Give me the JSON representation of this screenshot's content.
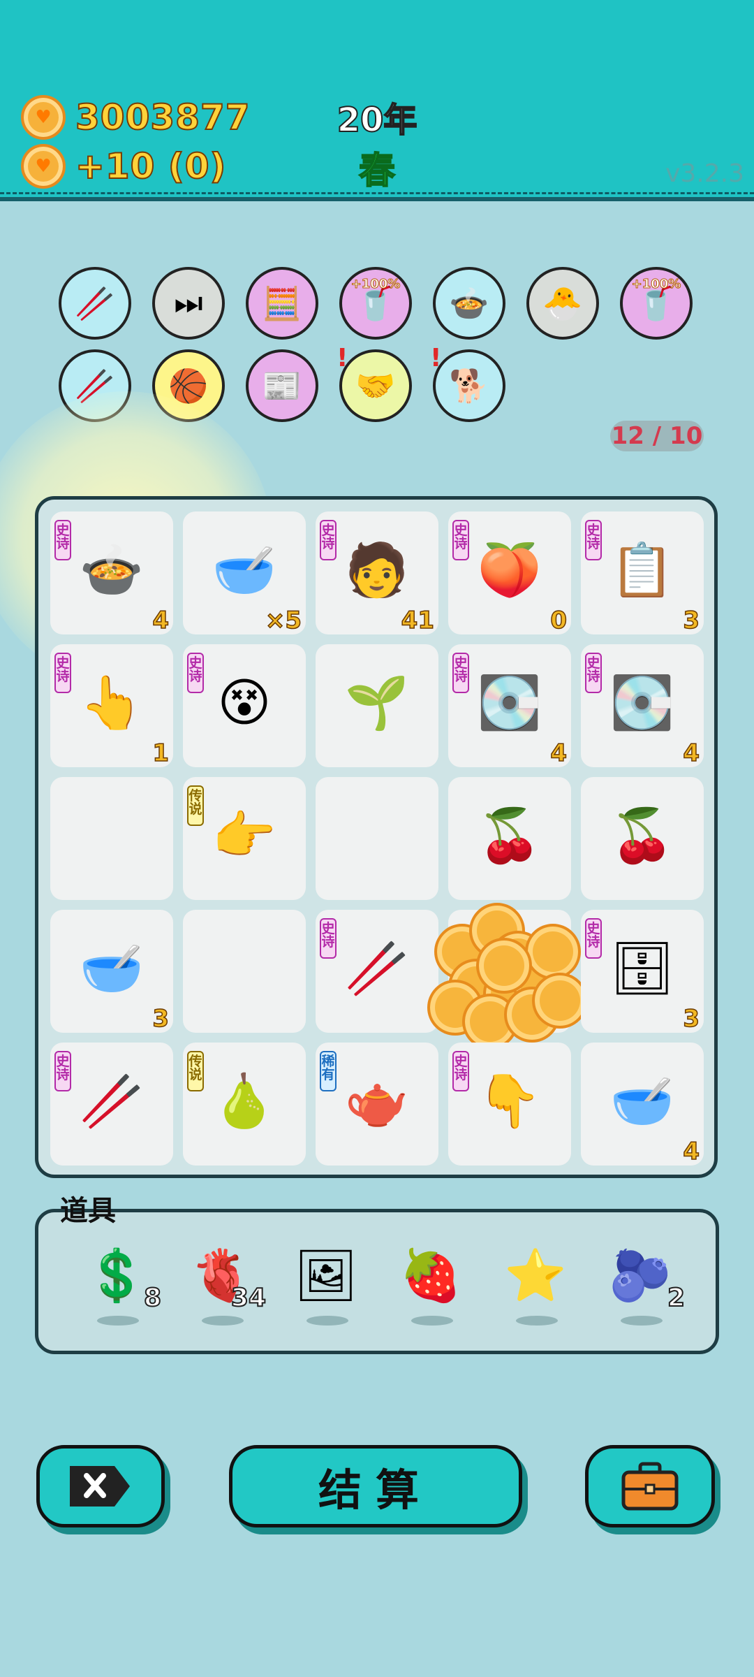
{
  "hud": {
    "coins": "3003877",
    "income": "+10   (0)",
    "year": "20年",
    "season": "春",
    "version": "v3.2.3"
  },
  "artifacts": [
    {
      "icon": "chopsticks",
      "emoji": "🥢",
      "color": "#b9ecf4"
    },
    {
      "icon": "skip-heart",
      "emoji": "⏭",
      "color": "#d9ddd9"
    },
    {
      "icon": "math-glasses",
      "emoji": "🧮",
      "color": "#e8aeea"
    },
    {
      "icon": "milk-tea-boost",
      "emoji": "🥤",
      "color": "#e8aeea",
      "badge": "+100%"
    },
    {
      "icon": "chick-pot",
      "emoji": "🍲",
      "color": "#b9ecf4"
    },
    {
      "icon": "chick-egg",
      "emoji": "🐣",
      "color": "#d9ddd9"
    },
    {
      "icon": "milk-tea-boost-2",
      "emoji": "🥤",
      "color": "#e8aeea",
      "badge": "+100%"
    },
    {
      "icon": "chopsticks-2",
      "emoji": "🥢",
      "color": "#b9ecf4"
    },
    {
      "icon": "basketballs",
      "emoji": "🏀",
      "color": "#fdf58a"
    },
    {
      "icon": "time-magazine",
      "emoji": "📰",
      "color": "#e8aeea"
    },
    {
      "icon": "handshake",
      "emoji": "🤝",
      "color": "#ecf7a7",
      "alert": "!"
    },
    {
      "icon": "shiba-dog",
      "emoji": "🐕",
      "color": "#b9ecf4",
      "alert": "!"
    }
  ],
  "counter": "12 / 10",
  "board": [
    {
      "tag": "史诗",
      "tagType": "epic",
      "icon": "steam-pot",
      "emoji": "🍲",
      "num": "4"
    },
    {
      "tag": "",
      "tagType": "",
      "icon": "tea-bowl",
      "emoji": "🥣",
      "num": "×5"
    },
    {
      "tag": "史诗",
      "tagType": "epic",
      "icon": "man-face",
      "emoji": "🧑",
      "num": "41"
    },
    {
      "tag": "史诗",
      "tagType": "epic",
      "icon": "peach",
      "emoji": "🍑",
      "num": "0"
    },
    {
      "tag": "史诗",
      "tagType": "epic",
      "icon": "copy-paste",
      "emoji": "📋",
      "num": "3"
    },
    {
      "tag": "史诗",
      "tagType": "epic",
      "icon": "pointing-hand-up",
      "emoji": "👆",
      "num": "1"
    },
    {
      "tag": "史诗",
      "tagType": "epic",
      "icon": "confused-face",
      "emoji": "😵",
      "num": ""
    },
    {
      "tag": "",
      "tagType": "",
      "icon": "sprout",
      "emoji": "🌱",
      "num": ""
    },
    {
      "tag": "史诗",
      "tagType": "epic",
      "icon": "graphics-card",
      "emoji": "💽",
      "num": "4"
    },
    {
      "tag": "史诗",
      "tagType": "epic",
      "icon": "graphics-card-2",
      "emoji": "💽",
      "num": "4"
    },
    {
      "tag": "",
      "tagType": "",
      "icon": "empty",
      "emoji": "",
      "num": ""
    },
    {
      "tag": "传说",
      "tagType": "legend",
      "icon": "pointing-hand-right",
      "emoji": "👉",
      "num": ""
    },
    {
      "tag": "",
      "tagType": "",
      "icon": "empty",
      "emoji": "",
      "num": ""
    },
    {
      "tag": "",
      "tagType": "",
      "icon": "cherries",
      "emoji": "🍒",
      "num": ""
    },
    {
      "tag": "",
      "tagType": "",
      "icon": "cherries-2",
      "emoji": "🍒",
      "num": ""
    },
    {
      "tag": "",
      "tagType": "",
      "icon": "tea-bowl-2",
      "emoji": "🥣",
      "num": "3"
    },
    {
      "tag": "",
      "tagType": "",
      "icon": "empty",
      "emoji": "",
      "num": ""
    },
    {
      "tag": "史诗",
      "tagType": "epic",
      "icon": "chopstick",
      "emoji": "🥢",
      "num": ""
    },
    {
      "tag": "",
      "tagType": "",
      "icon": "coin-burst",
      "emoji": "",
      "num": ""
    },
    {
      "tag": "史诗",
      "tagType": "epic",
      "icon": "server-rack",
      "emoji": "🗄",
      "num": "3"
    },
    {
      "tag": "史诗",
      "tagType": "epic",
      "icon": "chopstick-2",
      "emoji": "🥢",
      "num": ""
    },
    {
      "tag": "传说",
      "tagType": "legend",
      "icon": "golden-berries",
      "emoji": "🍐",
      "num": ""
    },
    {
      "tag": "稀有",
      "tagType": "rare",
      "icon": "teapot",
      "emoji": "🫖",
      "num": ""
    },
    {
      "tag": "史诗",
      "tagType": "epic",
      "icon": "pointing-hand-down",
      "emoji": "👇",
      "num": ""
    },
    {
      "tag": "",
      "tagType": "",
      "icon": "tea-bowl-3",
      "emoji": "🥣",
      "num": "4"
    }
  ],
  "items_title": "道具",
  "items": [
    {
      "icon": "dollar-coin",
      "emoji": "💲",
      "num": "8"
    },
    {
      "icon": "liver",
      "emoji": "🫀",
      "num": "34"
    },
    {
      "icon": "hand-frame",
      "emoji": "🖼",
      "num": ""
    },
    {
      "icon": "lychee",
      "emoji": "🍓",
      "num": ""
    },
    {
      "icon": "star",
      "emoji": "⭐",
      "num": ""
    },
    {
      "icon": "blueberry",
      "emoji": "🫐",
      "num": "2"
    }
  ],
  "buttons": {
    "settle_label": "结算",
    "close_icon": "close-icon",
    "bag_icon": "briefcase-icon"
  }
}
